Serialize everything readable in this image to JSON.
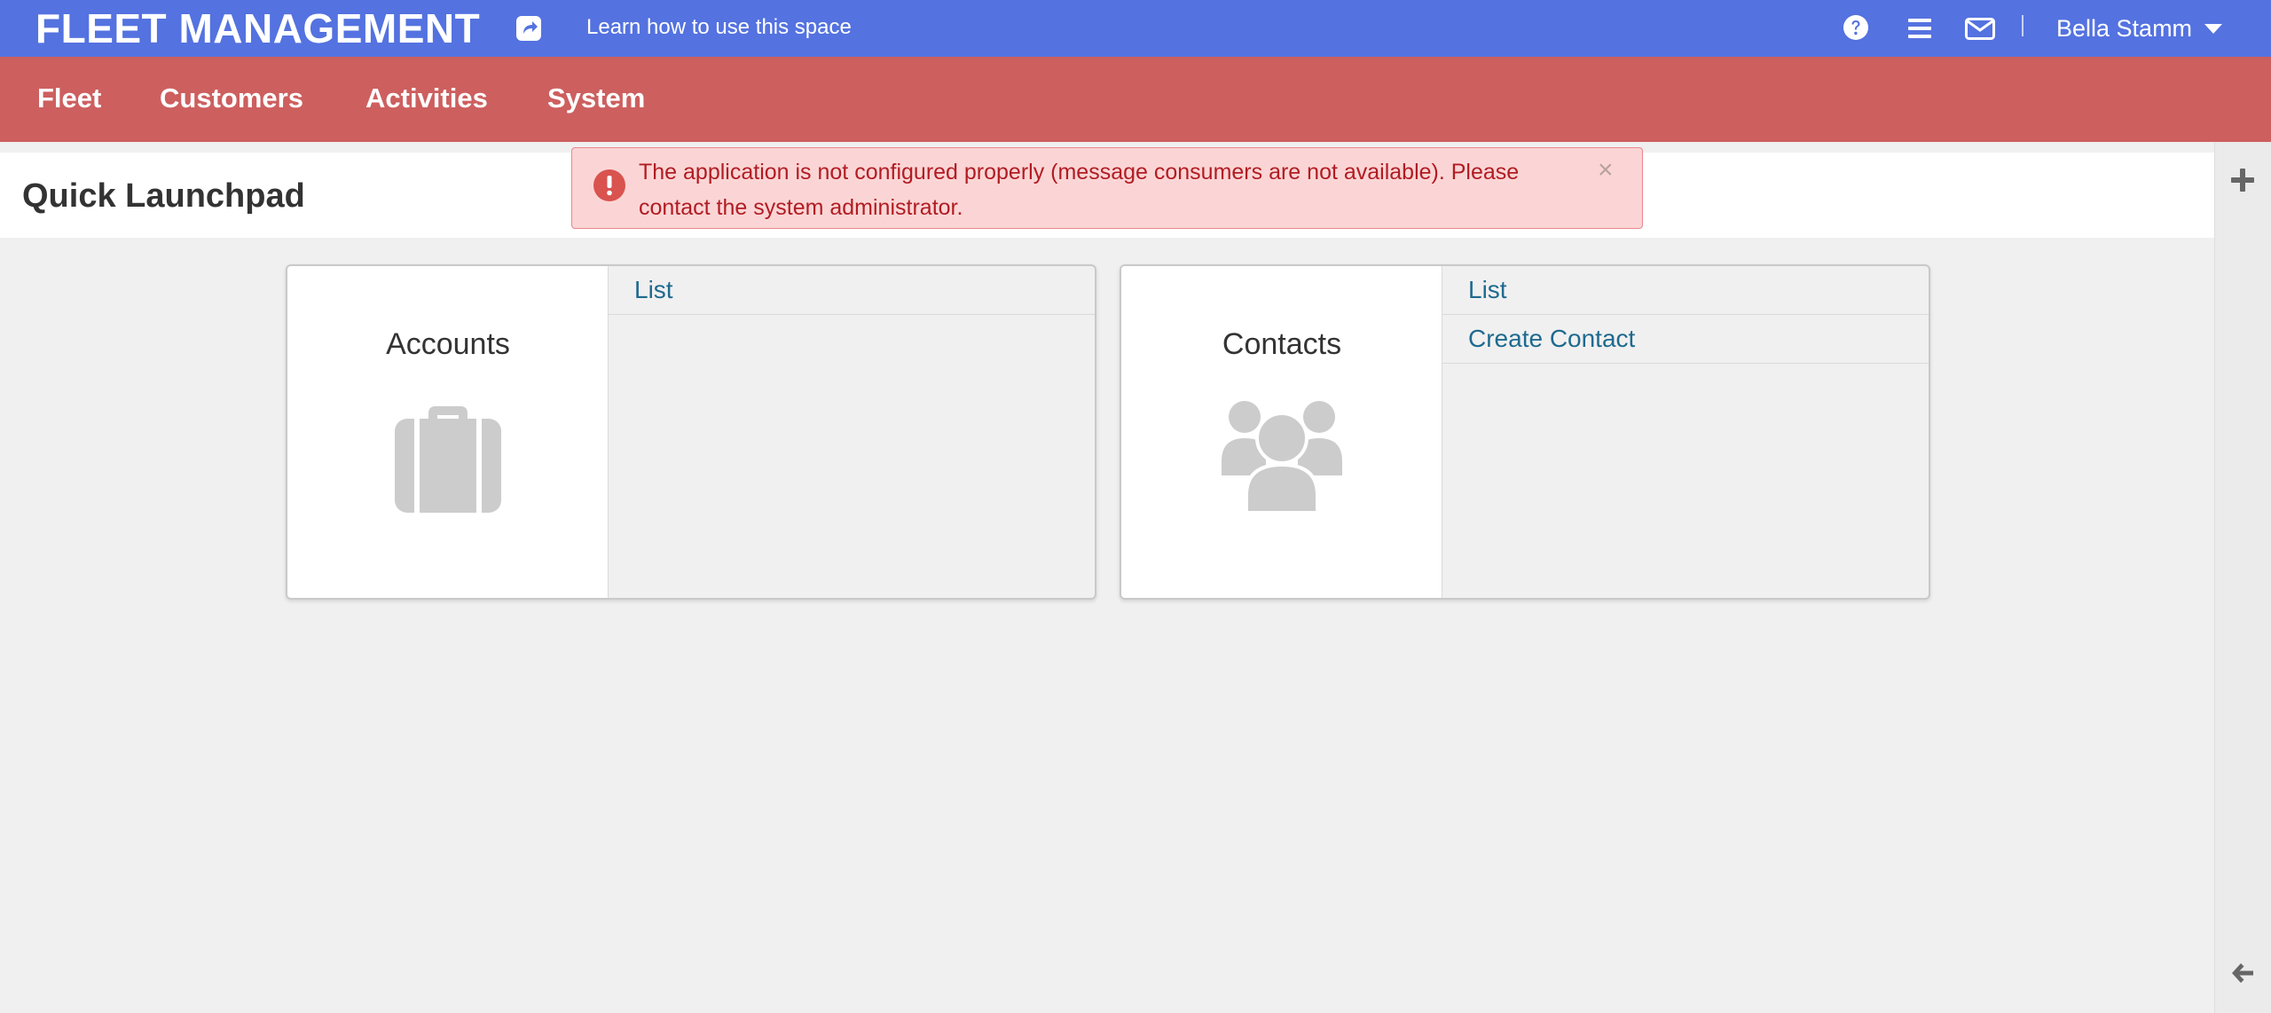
{
  "app": {
    "title": "FLEET MANAGEMENT",
    "learn_link": "Learn how to use this space",
    "user_name": "Bella Stamm"
  },
  "nav": {
    "items": [
      {
        "label": "Fleet"
      },
      {
        "label": "Customers"
      },
      {
        "label": "Activities"
      },
      {
        "label": "System"
      }
    ]
  },
  "page": {
    "title": "Quick Launchpad"
  },
  "alert": {
    "message": "The application is not configured properly (message consumers are not available). Please contact the system administrator.",
    "close_symbol": "×"
  },
  "cards": [
    {
      "title": "Accounts",
      "icon": "briefcase-icon",
      "links": [
        {
          "label": "List"
        }
      ]
    },
    {
      "title": "Contacts",
      "icon": "users-icon",
      "links": [
        {
          "label": "List"
        },
        {
          "label": "Create Contact"
        }
      ]
    }
  ],
  "colors": {
    "topbar": "#5472e0",
    "navbar": "#cd5f5f",
    "alert_bg": "#fbd5d5",
    "alert_text": "#b11c23",
    "link": "#1e6a8f",
    "icon_gray": "#cccccc"
  }
}
